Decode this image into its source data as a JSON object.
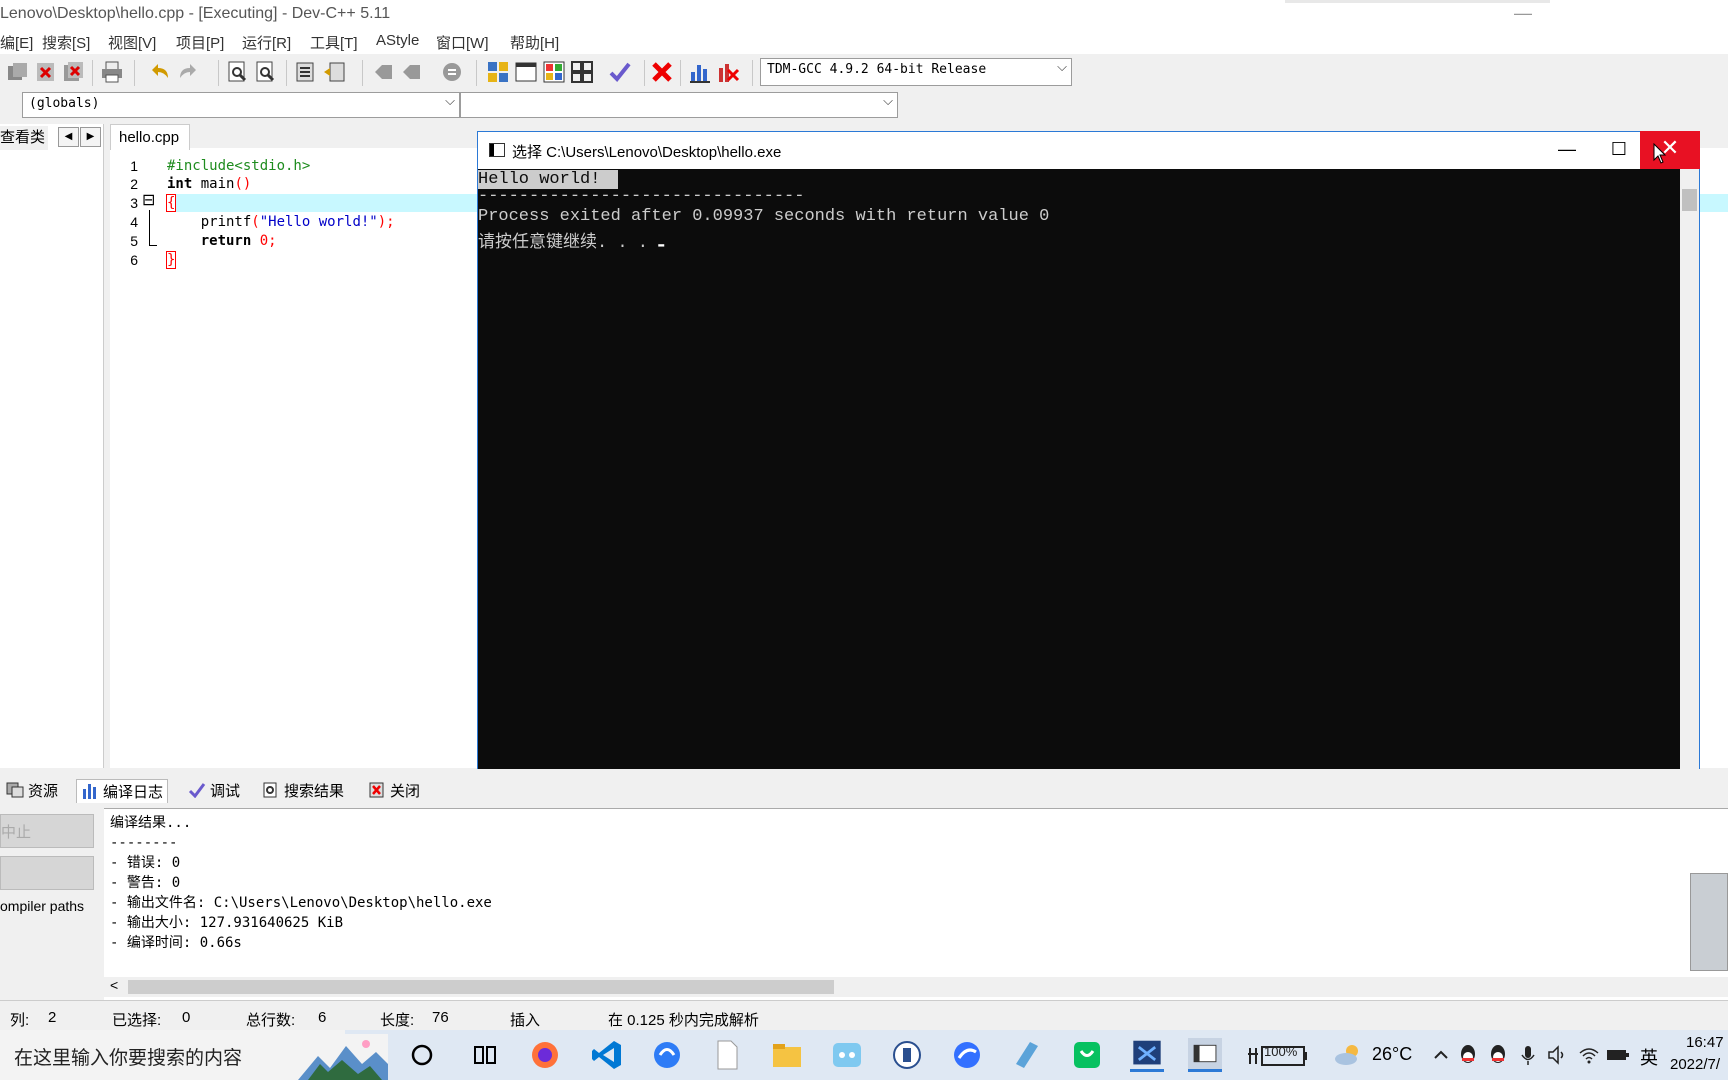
{
  "window": {
    "title": "Lenovo\\Desktop\\hello.cpp - [Executing] - Dev-C++ 5.11",
    "minimize_glyph": "—"
  },
  "menu": [
    "编[E]",
    "搜索[S]",
    "视图[V]",
    "项目[P]",
    "运行[R]",
    "工具[T]",
    "AStyle",
    "窗口[W]",
    "帮助[H]"
  ],
  "toolbar": {
    "compiler": "TDM-GCC 4.9.2 64-bit Release",
    "scope": "(globals)",
    "symbol": "",
    "dropdown_glyph": "⌵"
  },
  "left_panel": {
    "tab_label": "查看类",
    "prev_glyph": "◀",
    "next_glyph": "▶"
  },
  "editor": {
    "file_tab": "hello.cpp",
    "line_numbers": [
      "1",
      "2",
      "3",
      "4",
      "5",
      "6"
    ],
    "lines": {
      "l1": "#include<stdio.h>",
      "l2_kw": "int",
      "l2_rest": " main",
      "l2_paren": "()",
      "l3": "{",
      "l4_indent": "    printf",
      "l4_open": "(",
      "l4_str": "\"Hello world!\"",
      "l4_close": ");",
      "l5_kw": "    return",
      "l5_num": "0",
      "l5_semi": ";",
      "l6": "}"
    },
    "fold_glyph": "⊟"
  },
  "console": {
    "title": "选择 C:\\Users\\Lenovo\\Desktop\\hello.exe",
    "output": [
      "Hello world!",
      "--------------------------------",
      "Process exited after 0.09937 seconds with return value 0",
      "请按任意键继续. . . "
    ],
    "cursor": "▬",
    "min_glyph": "—",
    "max_glyph": "☐",
    "close_glyph": "✕"
  },
  "bottom_tabs": [
    "资源",
    "编译日志",
    "调试",
    "搜索结果",
    "关闭"
  ],
  "compile_log": {
    "lines": [
      "编译结果...",
      "--------",
      "- 错误: 0",
      "- 警告: 0",
      "- 输出文件名: C:\\Users\\Lenovo\\Desktop\\hello.exe",
      "- 输出大小: 127.931640625 KiB",
      "- 编译时间: 0.66s"
    ],
    "scroll_left_glyph": "<"
  },
  "left_buttons": {
    "abort": "中止",
    "blank": "",
    "compiler_paths": "ompiler paths"
  },
  "status": {
    "col_label": "列:",
    "col_value": "2",
    "selected_label": "已选择:",
    "selected_value": "0",
    "total_label": "总行数:",
    "total_value": "6",
    "length_label": "长度:",
    "length_value": "76",
    "mode": "插入",
    "parse_msg": "在 0.125 秒内完成解析"
  },
  "taskbar": {
    "search_placeholder": "在这里输入你要搜索的内容",
    "battery": "100%",
    "temperature": "26°C",
    "ime": "英",
    "time": "16:47",
    "date": "2022/7/"
  },
  "colors": {
    "accent": "#2b79d6",
    "close_red": "#e81123",
    "console_bg": "#0c0c0c",
    "current_line": "#c8f8ff"
  }
}
